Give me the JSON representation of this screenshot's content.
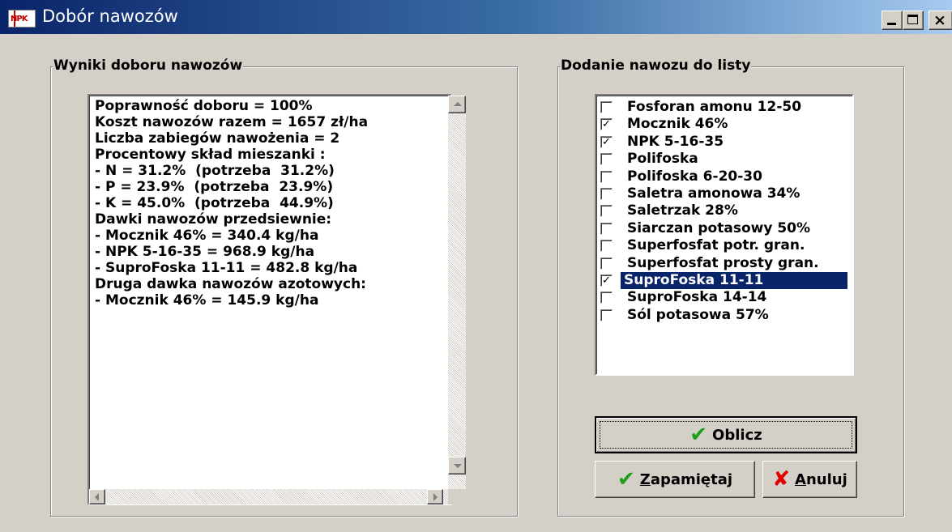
{
  "window": {
    "title": "Dobór nawozów",
    "icon_text": "NPK",
    "controls": {
      "minimize": "_",
      "close": "×"
    }
  },
  "results_group": {
    "title": "Wyniki doboru nawozów",
    "lines": [
      "Poprawność doboru = 100%",
      "Koszt nawozów razem = 1657 zł/ha",
      "Liczba zabiegów nawożenia = 2",
      "Procentowy skład mieszanki :",
      "- N = 31.2%  (potrzeba  31.2%)",
      "- P = 23.9%  (potrzeba  23.9%)",
      "- K = 45.0%  (potrzeba  44.9%)",
      "Dawki nawozów przedsiewnie:",
      "- Mocznik 46% = 340.4 kg/ha",
      "- NPK 5-16-35 = 968.9 kg/ha",
      "- SuproFoska 11-11 = 482.8 kg/ha",
      "Druga dawka nawozów azotowych:",
      "- Mocznik 46% = 145.9 kg/ha"
    ]
  },
  "fertilizer_group": {
    "title": "Dodanie nawozu do listy",
    "check_mark": "✓",
    "items": [
      {
        "label": "Fosforan amonu 12-50",
        "checked": false,
        "selected": false
      },
      {
        "label": "Mocznik 46%",
        "checked": true,
        "selected": false
      },
      {
        "label": "NPK 5-16-35",
        "checked": true,
        "selected": false
      },
      {
        "label": "Polifoska",
        "checked": false,
        "selected": false
      },
      {
        "label": "Polifoska 6-20-30",
        "checked": false,
        "selected": false
      },
      {
        "label": "Saletra amonowa 34%",
        "checked": false,
        "selected": false
      },
      {
        "label": "Saletrzak 28%",
        "checked": false,
        "selected": false
      },
      {
        "label": "Siarczan potasowy 50%",
        "checked": false,
        "selected": false
      },
      {
        "label": "Superfosfat potr. gran.",
        "checked": false,
        "selected": false
      },
      {
        "label": "Superfosfat prosty gran.",
        "checked": false,
        "selected": false
      },
      {
        "label": "SuproFoska 11-11",
        "checked": true,
        "selected": true
      },
      {
        "label": "SuproFoska 14-14",
        "checked": false,
        "selected": false
      },
      {
        "label": "Sól potasowa 57%",
        "checked": false,
        "selected": false
      }
    ]
  },
  "buttons": {
    "calculate": {
      "label": "Oblicz",
      "icon_glyph": "✔"
    },
    "save": {
      "hotkey": "Z",
      "rest": "apamiętaj",
      "icon_glyph": "✔"
    },
    "cancel": {
      "hotkey": "A",
      "rest": "nuluj",
      "icon_glyph": "✘"
    }
  },
  "colors": {
    "selection": "#0a246a",
    "window_face": "#d4d0c8",
    "check_icon": "#1aa01a",
    "cancel_icon": "#e00000"
  }
}
